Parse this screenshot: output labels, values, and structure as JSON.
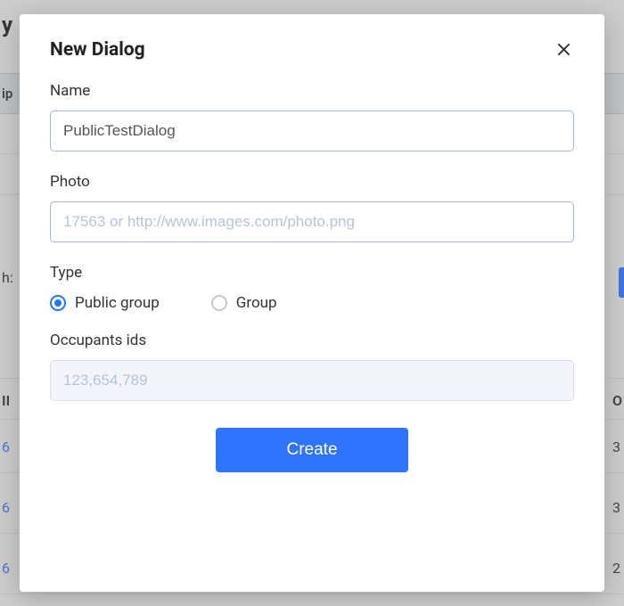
{
  "background": {
    "titleFragment": "y",
    "headerLeft": "ip",
    "searchLabel": "h:",
    "idHeader": "II",
    "rightHeaderFragment": "O",
    "rows": [
      {
        "leftId": "6",
        "right": "3"
      },
      {
        "leftId": "6",
        "right": "3"
      },
      {
        "leftId": "6",
        "right": "2"
      }
    ]
  },
  "modal": {
    "title": "New Dialog",
    "closeAria": "Close",
    "name": {
      "label": "Name",
      "value": "PublicTestDialog"
    },
    "photo": {
      "label": "Photo",
      "placeholder": "17563 or http://www.images.com/photo.png",
      "value": ""
    },
    "type": {
      "label": "Type",
      "options": [
        {
          "label": "Public group",
          "checked": true
        },
        {
          "label": "Group",
          "checked": false
        }
      ]
    },
    "occupants": {
      "label": "Occupants ids",
      "placeholder": "123,654,789",
      "value": ""
    },
    "createLabel": "Create"
  }
}
